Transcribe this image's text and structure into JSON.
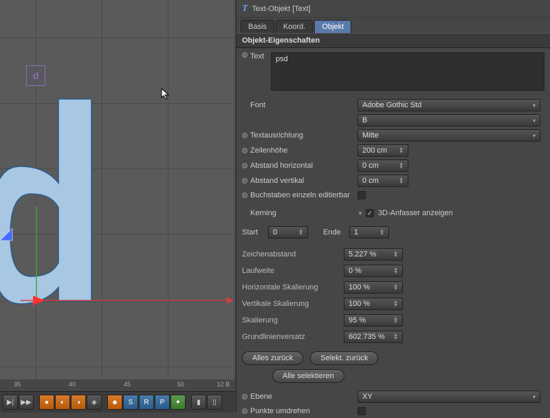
{
  "panel": {
    "title": "Text-Objekt [Text]",
    "tabs": [
      "Basis",
      "Koord.",
      "Objekt"
    ],
    "active_tab": 2,
    "section": "Objekt-Eigenschaften",
    "text_label": "Text",
    "text_value": "psd",
    "font_label": "Font",
    "font_value": "Adobe Gothic Std",
    "font_weight": "B",
    "align_label": "Textausrichtung",
    "align_value": "Mitte",
    "lineheight_label": "Zeilenhöhe",
    "lineheight_value": "200 cm",
    "hspace_label": "Abstand horizontal",
    "hspace_value": "0 cm",
    "vspace_label": "Abstand vertikal",
    "vspace_value": "0 cm",
    "editable_label": "Buchstaben einzeln editierbar",
    "kerning_label": "Kerning",
    "kerning_3d_label": "3D-Anfasser anzeigen",
    "start_label": "Start",
    "start_value": "0",
    "end_label": "Ende",
    "end_value": "1",
    "tracking_label": "Zeichenabstand",
    "tracking_value": "5.227 %",
    "run_label": "Laufweite",
    "run_value": "0 %",
    "hscale_label": "Horizontale Skalierung",
    "hscale_value": "100 %",
    "vscale_label": "Vertikale Skalierung",
    "vscale_value": "100 %",
    "scale_label": "Skalierung",
    "scale_value": "95 %",
    "baseline_label": "Grundlinienversatz",
    "baseline_value": "602.735 %",
    "reset_all": "Alles zurück",
    "reset_sel": "Selekt. zurück",
    "select_all": "Alle selektieren",
    "plane_label": "Ebene",
    "plane_value": "XY",
    "reverse_label": "Punkte umdrehen"
  },
  "viewport": {
    "sel_char": "d"
  },
  "timeline": {
    "ticks": [
      "35",
      "40",
      "45",
      "50"
    ],
    "frames": "12 B"
  }
}
